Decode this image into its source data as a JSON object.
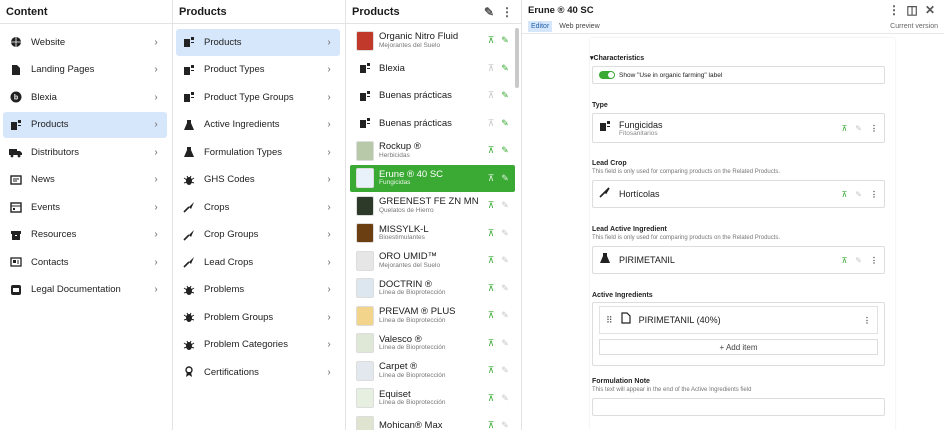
{
  "col1": {
    "title": "Content",
    "items": [
      {
        "label": "Website",
        "icon": "globe-icon"
      },
      {
        "label": "Landing Pages",
        "icon": "page-icon"
      },
      {
        "label": "Blexia",
        "icon": "blexia-logo-icon"
      },
      {
        "label": "Products",
        "icon": "product-icon"
      },
      {
        "label": "Distributors",
        "icon": "truck-icon"
      },
      {
        "label": "News",
        "icon": "news-icon"
      },
      {
        "label": "Events",
        "icon": "calendar-icon"
      },
      {
        "label": "Resources",
        "icon": "archive-icon"
      },
      {
        "label": "Contacts",
        "icon": "contact-card-icon"
      },
      {
        "label": "Legal Documentation",
        "icon": "legal-icon"
      }
    ]
  },
  "col2": {
    "title": "Products",
    "items": [
      {
        "label": "Products",
        "icon": "product-icon"
      },
      {
        "label": "Product Types",
        "icon": "product-icon"
      },
      {
        "label": "Product Type Groups",
        "icon": "product-icon"
      },
      {
        "label": "Active Ingredients",
        "icon": "flask-icon"
      },
      {
        "label": "Formulation Types",
        "icon": "flask-icon"
      },
      {
        "label": "GHS Codes",
        "icon": "bug-icon"
      },
      {
        "label": "Crops",
        "icon": "sprout-icon"
      },
      {
        "label": "Crop Groups",
        "icon": "sprout-icon"
      },
      {
        "label": "Lead Crops",
        "icon": "sprout-icon"
      },
      {
        "label": "Problems",
        "icon": "bug-icon"
      },
      {
        "label": "Problem Groups",
        "icon": "bug-icon"
      },
      {
        "label": "Problem Categories",
        "icon": "bug-icon"
      },
      {
        "label": "Certifications",
        "icon": "ribbon-icon"
      }
    ]
  },
  "col3": {
    "title": "Products",
    "items": [
      {
        "name": "Organic Nitro Fluid",
        "sub": "Mejorantes del Suelo",
        "thumb": "#c0392b",
        "published": true
      },
      {
        "name": "Blexia",
        "sub": "",
        "thumb": "",
        "published": false
      },
      {
        "name": "Buenas prácticas",
        "sub": "",
        "thumb": "",
        "published": false
      },
      {
        "name": "Buenas prácticas",
        "sub": "",
        "thumb": "",
        "published": false
      },
      {
        "name": "Rockup ®",
        "sub": "Herbicidas",
        "thumb": "#b7c9a8",
        "published": true
      },
      {
        "name": "Erune ® 40 SC",
        "sub": "Fungicidas",
        "thumb": "#e9f2fb",
        "published": true
      },
      {
        "name": "GREENEST FE ZN MN",
        "sub": "Quelatos de Hierro",
        "thumb": "#2d3a2a",
        "published": true
      },
      {
        "name": "MISSYLK-L",
        "sub": "Bioestimulantes",
        "thumb": "#6b3f12",
        "published": true
      },
      {
        "name": "ORO UMID™",
        "sub": "Mejorantes del Suelo",
        "thumb": "#e6e6e6",
        "published": true
      },
      {
        "name": "DOCTRIN ®",
        "sub": "Línea de Bioprotección",
        "thumb": "#dde7ef",
        "published": true
      },
      {
        "name": "PREVAM ® PLUS",
        "sub": "Línea de Bioprotección",
        "thumb": "#f2d48a",
        "published": true
      },
      {
        "name": "Valesco ®",
        "sub": "Línea de Bioprotección",
        "thumb": "#dfe8d6",
        "published": true
      },
      {
        "name": "Carpet ®",
        "sub": "Línea de Bioprotección",
        "thumb": "#e3e8ee",
        "published": true
      },
      {
        "name": "Equiset",
        "sub": "Línea de Bioprotección",
        "thumb": "#e7efe0",
        "published": true
      },
      {
        "name": "Mohican® Max",
        "sub": "",
        "thumb": "#dfe4d0",
        "published": true
      }
    ]
  },
  "editor": {
    "title": "Erune ® 40 SC",
    "tab_editor": "Editor",
    "tab_preview": "Web preview",
    "current_version": "Current version",
    "characteristics": "Characteristics",
    "toggle_label": "Show \"Use in organic farming\" label",
    "type_label": "Type",
    "type_value": "Fungicidas",
    "type_sub": "Fitosanitarios",
    "lead_crop_label": "Lead Crop",
    "lead_crop_help": "This field is only used for comparing products on the Related Products.",
    "lead_crop_value": "Hortícolas",
    "lead_ai_label": "Lead Active Ingredient",
    "lead_ai_help": "This field is only used for comparing products on the Related Products.",
    "lead_ai_value": "PIRIMETANIL",
    "ai_label": "Active Ingredients",
    "ai_value": "PIRIMETANIL (40%)",
    "add_item": "+ Add item",
    "form_note_label": "Formulation Note",
    "form_note_help": "This text will appear in the end of the Active Ingredients field"
  }
}
